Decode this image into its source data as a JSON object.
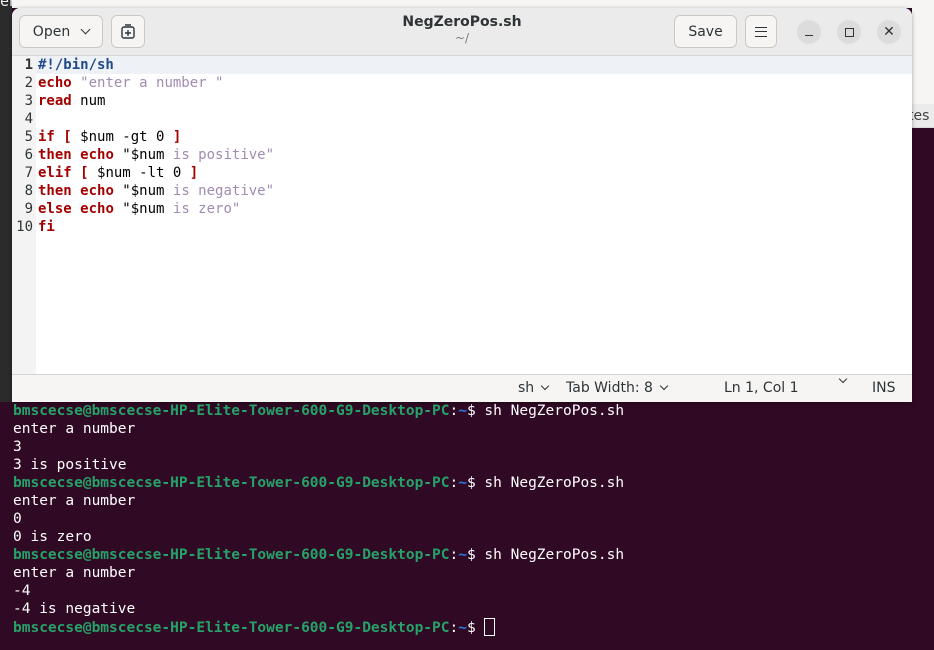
{
  "background": {
    "left_fragment": "enter",
    "right_tab_fragment": "tes"
  },
  "gedit": {
    "open_label": "Open",
    "title": "NegZeroPos.sh",
    "subtitle": "~/",
    "save_label": "Save"
  },
  "editor": {
    "lines": [
      {
        "n": "1",
        "parts": [
          {
            "t": "#!/bin/sh",
            "c": "sheb"
          }
        ]
      },
      {
        "n": "2",
        "parts": [
          {
            "t": "echo",
            "c": "kw"
          },
          {
            "t": " ",
            "c": ""
          },
          {
            "t": "\"enter a number \"",
            "c": "str"
          }
        ]
      },
      {
        "n": "3",
        "parts": [
          {
            "t": "read",
            "c": "kw"
          },
          {
            "t": " num",
            "c": ""
          }
        ]
      },
      {
        "n": "4",
        "parts": []
      },
      {
        "n": "5",
        "parts": [
          {
            "t": "if",
            "c": "kw"
          },
          {
            "t": " ",
            "c": ""
          },
          {
            "t": "[",
            "c": "kw"
          },
          {
            "t": " $num -gt 0 ",
            "c": ""
          },
          {
            "t": "]",
            "c": "kw"
          }
        ]
      },
      {
        "n": "6",
        "parts": [
          {
            "t": "then",
            "c": "kw"
          },
          {
            "t": " ",
            "c": ""
          },
          {
            "t": "echo",
            "c": "kw"
          },
          {
            "t": " \"$num ",
            "c": ""
          },
          {
            "t": "is positive\"",
            "c": "str"
          }
        ]
      },
      {
        "n": "7",
        "parts": [
          {
            "t": "elif",
            "c": "kw"
          },
          {
            "t": " ",
            "c": ""
          },
          {
            "t": "[",
            "c": "kw"
          },
          {
            "t": " $num -lt 0 ",
            "c": ""
          },
          {
            "t": "]",
            "c": "kw"
          }
        ]
      },
      {
        "n": "8",
        "parts": [
          {
            "t": "then",
            "c": "kw"
          },
          {
            "t": " ",
            "c": ""
          },
          {
            "t": "echo",
            "c": "kw"
          },
          {
            "t": " \"$num ",
            "c": ""
          },
          {
            "t": "is negative\"",
            "c": "str"
          }
        ]
      },
      {
        "n": "9",
        "parts": [
          {
            "t": "else",
            "c": "kw"
          },
          {
            "t": " ",
            "c": ""
          },
          {
            "t": "echo",
            "c": "kw"
          },
          {
            "t": " \"$num ",
            "c": ""
          },
          {
            "t": "is zero\"",
            "c": "str"
          }
        ]
      },
      {
        "n": "10",
        "parts": [
          {
            "t": "fi",
            "c": "kw"
          }
        ]
      }
    ]
  },
  "statusbar": {
    "language": "sh",
    "tab_width": "Tab Width: 8",
    "position": "Ln 1, Col 1",
    "mode": "INS"
  },
  "terminal": {
    "prompt_user": "bmscecse@bmscecse-HP-Elite-Tower-600-G9-Desktop-PC",
    "prompt_path": "~",
    "lines": [
      {
        "type": "prompt",
        "cmd": "sh NegZeroPos.sh"
      },
      {
        "type": "out",
        "text": "enter a number"
      },
      {
        "type": "out",
        "text": "3"
      },
      {
        "type": "out",
        "text": "3 is positive"
      },
      {
        "type": "prompt",
        "cmd": "sh NegZeroPos.sh"
      },
      {
        "type": "out",
        "text": "enter a number"
      },
      {
        "type": "out",
        "text": "0"
      },
      {
        "type": "out",
        "text": "0 is zero"
      },
      {
        "type": "prompt",
        "cmd": "sh NegZeroPos.sh"
      },
      {
        "type": "out",
        "text": "enter a number"
      },
      {
        "type": "out",
        "text": "-4"
      },
      {
        "type": "out",
        "text": "-4 is negative"
      },
      {
        "type": "prompt",
        "cmd": "",
        "cursor": true
      }
    ]
  },
  "colors": {
    "terminal_bg": "#300a24",
    "prompt_user": "#26a269",
    "prompt_path": "#2a7bde",
    "keyword": "#a40000",
    "string": "#a18bb1"
  }
}
